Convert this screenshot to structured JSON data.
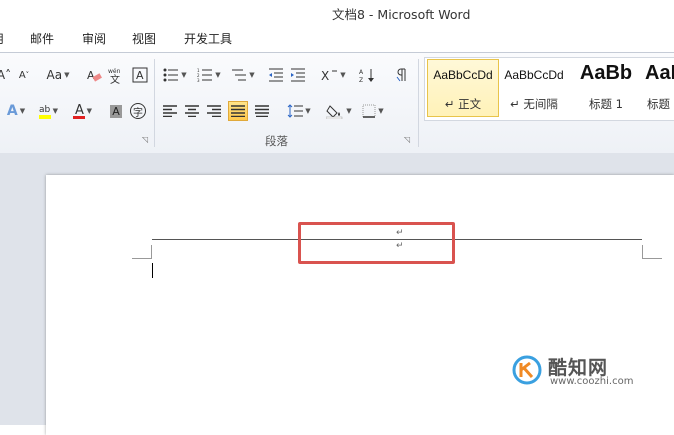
{
  "window": {
    "title": "文档8 - Microsoft Word"
  },
  "menu": {
    "items": [
      {
        "label": "用"
      },
      {
        "label": "邮件"
      },
      {
        "label": "审阅"
      },
      {
        "label": "视图"
      },
      {
        "label": "开发工具"
      }
    ]
  },
  "ribbon": {
    "font_group": {
      "shrink_font": "A",
      "change_case": "Aa",
      "font_color_letter": "A",
      "char_shading": "A",
      "enclose_char": "字"
    },
    "paragraph_group": {
      "label": "段落"
    },
    "styles": [
      {
        "sample": "AaBbCcDd",
        "name": "↵ 正文",
        "selected": true
      },
      {
        "sample": "AaBbCcDd",
        "name": "↵ 无间隔",
        "selected": false
      },
      {
        "sample": "AaBb",
        "name": "标题 1",
        "selected": false
      },
      {
        "sample": "AaB",
        "name": "标题",
        "selected": false
      }
    ]
  },
  "document": {
    "header_marks": [
      "↵",
      "↵"
    ]
  },
  "watermark": {
    "title": "酷知网",
    "url": "www.coozhi.com"
  }
}
